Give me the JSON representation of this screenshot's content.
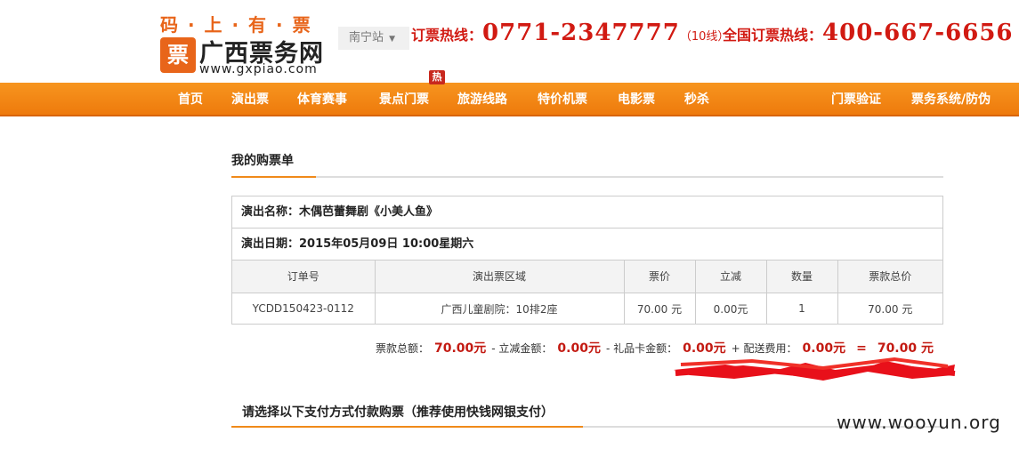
{
  "header": {
    "slogan": "码 · 上 · 有 · 票",
    "logo_name": "广西票务网",
    "logo_url": "www.gxpiao.com",
    "city": "南宁站",
    "hotline_label": "订票热线：",
    "hotline_number": "0771-2347777",
    "hotline_note": "（10线）",
    "national_label": "全国订票热线：",
    "national_number": "400-667-6656"
  },
  "nav": {
    "items": [
      "首页",
      "演出票",
      "体育赛事",
      "景点门票",
      "旅游线路",
      "特价机票",
      "电影票",
      "秒杀",
      "门票验证",
      "票务系统/防伪"
    ],
    "hot_badge": "热"
  },
  "order": {
    "section_title": "我的购票单",
    "show_name_label": "演出名称：",
    "show_name": "木偶芭蕾舞剧《小美人鱼》",
    "show_date_label": "演出日期：",
    "show_date": "2015年05月09日 10:00星期六",
    "table": {
      "headers": [
        "订单号",
        "演出票区域",
        "票价",
        "立减",
        "数量",
        "票款总价"
      ],
      "row": [
        "YCDD150423-0112",
        "广西儿童剧院：10排2座",
        "70.00 元",
        "0.00元",
        "1",
        "70.00 元"
      ]
    },
    "totals": {
      "ticket_total_label": "票款总额：",
      "ticket_total": "70.00元",
      "discount_label": "- 立减金额：",
      "discount": "0.00元",
      "gift_label": "- 礼品卡金额：",
      "gift": "0.00元",
      "delivery_label": "+ 配送费用：",
      "delivery": "0.00元",
      "equals": "=",
      "grand_total": "70.00 元"
    }
  },
  "payment": {
    "title": "请选择以下支付方式付款购票（推荐使用快钱网银支付）"
  },
  "watermark": "www.wooyun.org",
  "colors": {
    "brand_orange": "#f08a1a",
    "hotline_red": "#d11a12",
    "redaction_red": "#e8101a"
  }
}
